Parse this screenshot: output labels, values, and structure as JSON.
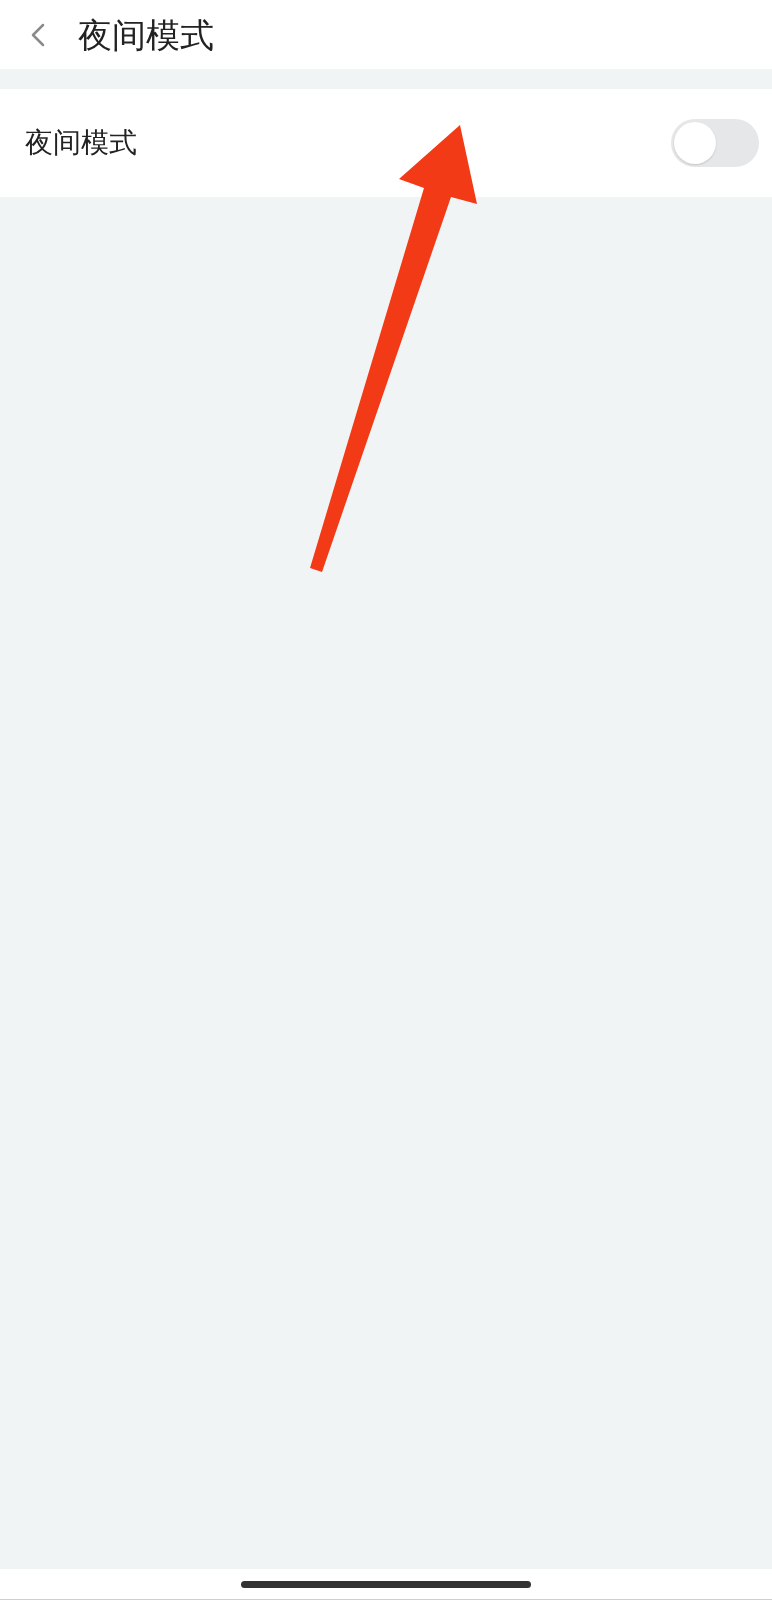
{
  "header": {
    "title": "夜间模式"
  },
  "settings": [
    {
      "kind": "toggle",
      "label": "夜间模式",
      "on": false
    }
  ]
}
